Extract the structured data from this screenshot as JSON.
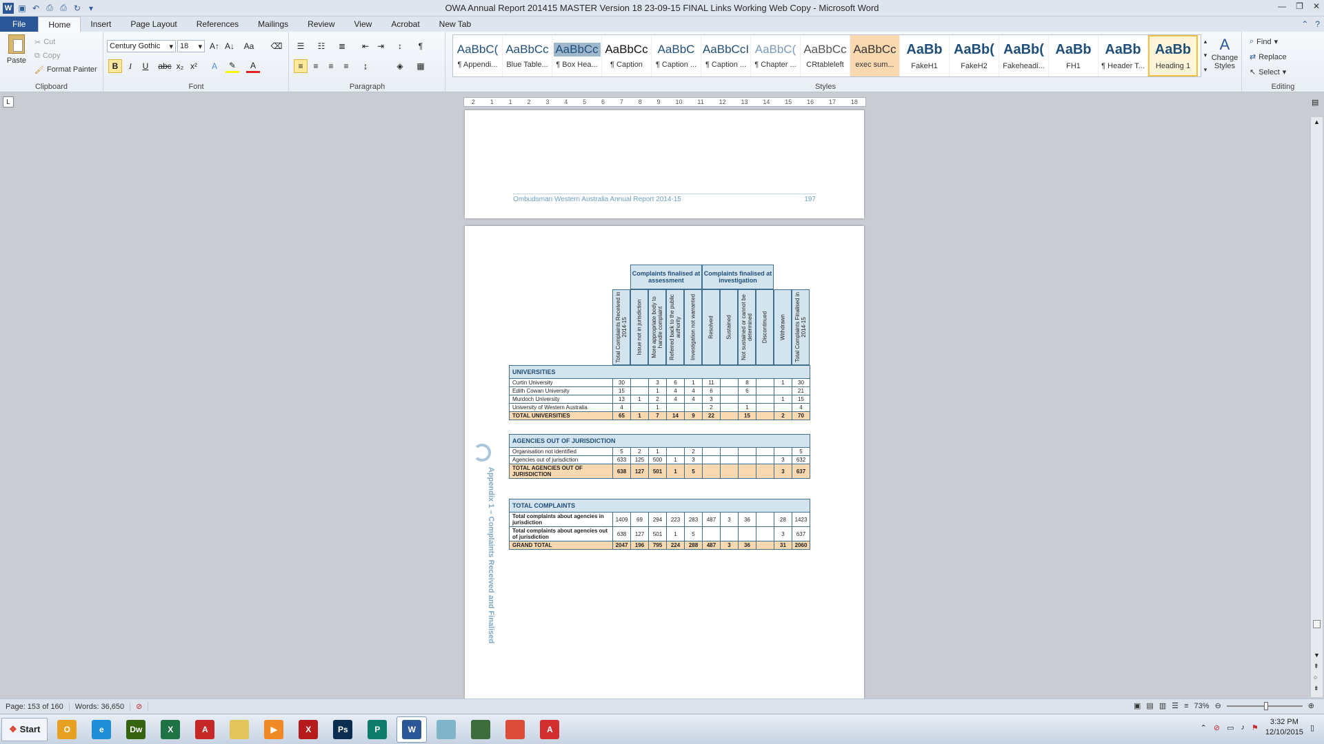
{
  "window": {
    "title": "OWA Annual Report 201415 MASTER Version 18 23-09-15 FINAL Links Working Web Copy - Microsoft Word"
  },
  "tabs": [
    "File",
    "Home",
    "Insert",
    "Page Layout",
    "References",
    "Mailings",
    "Review",
    "View",
    "Acrobat",
    "New Tab"
  ],
  "ribbon": {
    "clipboard": {
      "paste": "Paste",
      "cut": "Cut",
      "copy": "Copy",
      "format_painter": "Format Painter",
      "label": "Clipboard"
    },
    "font": {
      "name": "Century Gothic",
      "size": "18",
      "label": "Font"
    },
    "paragraph": {
      "label": "Paragraph"
    },
    "styles": {
      "label": "Styles",
      "items": [
        {
          "sample": "AaBbC(",
          "name": "¶ Appendi..."
        },
        {
          "sample": "AaBbCc",
          "name": "Blue Table..."
        },
        {
          "sample": "AaBbCc",
          "name": "¶ Box Hea..."
        },
        {
          "sample": "AaBbCc",
          "name": "¶ Caption"
        },
        {
          "sample": "AaBbC",
          "name": "¶ Caption ..."
        },
        {
          "sample": "AaBbCcI",
          "name": "¶ Caption ..."
        },
        {
          "sample": "AaBbC(",
          "name": "¶ Chapter ..."
        },
        {
          "sample": "AaBbCc",
          "name": "CRtableleft"
        },
        {
          "sample": "AaBbCc",
          "name": "exec sum..."
        },
        {
          "sample": "AaBb",
          "name": "FakeH1"
        },
        {
          "sample": "AaBb(",
          "name": "FakeH2"
        },
        {
          "sample": "AaBb(",
          "name": "Fakeheadi..."
        },
        {
          "sample": "AaBb",
          "name": "FH1"
        },
        {
          "sample": "AaBb",
          "name": "¶ Header T..."
        },
        {
          "sample": "AaBb",
          "name": "Heading 1"
        }
      ],
      "change_styles": "Change Styles"
    },
    "editing": {
      "find": "Find",
      "replace": "Replace",
      "select": "Select",
      "label": "Editing"
    }
  },
  "ruler": [
    "2",
    "1",
    "1",
    "2",
    "3",
    "4",
    "5",
    "6",
    "7",
    "8",
    "9",
    "10",
    "11",
    "12",
    "13",
    "14",
    "15",
    "16",
    "17",
    "18"
  ],
  "page1": {
    "footer": "Ombudsman Western Australia Annual Report 2014-15",
    "page_number": "197"
  },
  "page2": {
    "side_text": "Appendix 1 – Complaints Received and Finalised",
    "group_headers": [
      "Complaints finalised at assessment",
      "Complaints finalised at investigation"
    ],
    "column_headers": [
      "Total Complaints Received in 2014-15",
      "Issue not in jurisdiction",
      "More appropriate body to handle complaint",
      "Referred back to the public authority",
      "Investigation not warranted",
      "Resolved",
      "Sustained",
      "Not sustained or cannot be determined",
      "Discontinued",
      "Withdrawn",
      "Total Complaints Finalised in 2014-15"
    ],
    "sections": [
      {
        "title": "UNIVERSITIES",
        "rows": [
          {
            "label": "Curtin University",
            "values": [
              "30",
              "",
              "3",
              "6",
              "1",
              "11",
              "",
              "8",
              "",
              "1",
              "30"
            ]
          },
          {
            "label": "Edith Cowan University",
            "values": [
              "15",
              "",
              "1",
              "4",
              "4",
              "6",
              "",
              "6",
              "",
              "",
              "21"
            ]
          },
          {
            "label": "Murdoch University",
            "values": [
              "13",
              "1",
              "2",
              "4",
              "4",
              "3",
              "",
              "",
              "",
              "1",
              "15"
            ]
          },
          {
            "label": "University of Western Australia",
            "values": [
              "4",
              "",
              "1",
              "",
              "",
              "2",
              "",
              "1",
              "",
              "",
              "4"
            ]
          }
        ],
        "total": {
          "label": "TOTAL UNIVERSITIES",
          "values": [
            "65",
            "1",
            "7",
            "14",
            "9",
            "22",
            "",
            "15",
            "",
            "2",
            "70"
          ]
        }
      },
      {
        "title": "AGENCIES OUT OF JURISDICTION",
        "rows": [
          {
            "label": "Organisation not identified",
            "values": [
              "5",
              "2",
              "1",
              "",
              "2",
              "",
              "",
              "",
              "",
              "",
              "5"
            ]
          },
          {
            "label": "Agencies out of jurisdiction",
            "values": [
              "633",
              "125",
              "500",
              "1",
              "3",
              "",
              "",
              "",
              "",
              "3",
              "632"
            ]
          }
        ],
        "total": {
          "label": "TOTAL AGENCIES OUT OF JURISDICTION",
          "values": [
            "638",
            "127",
            "501",
            "1",
            "5",
            "",
            "",
            "",
            "",
            "3",
            "637"
          ]
        }
      },
      {
        "title": "TOTAL COMPLAINTS",
        "rows": [
          {
            "label": "Total complaints about agencies in jurisdiction",
            "values": [
              "1409",
              "69",
              "294",
              "223",
              "283",
              "487",
              "3",
              "36",
              "",
              "28",
              "1423"
            ],
            "bold": true
          },
          {
            "label": "Total complaints about agencies out of jurisdiction",
            "values": [
              "638",
              "127",
              "501",
              "1",
              "5",
              "",
              "",
              "",
              "",
              "3",
              "637"
            ],
            "bold": true
          }
        ],
        "total": {
          "label": "GRAND TOTAL",
          "values": [
            "2047",
            "196",
            "795",
            "224",
            "288",
            "487",
            "3",
            "36",
            "",
            "31",
            "2060"
          ]
        }
      }
    ]
  },
  "status": {
    "page": "Page: 153 of 160",
    "words": "Words: 36,650",
    "zoom": "73%"
  },
  "taskbar": {
    "start": "Start",
    "apps": [
      {
        "name": "outlook",
        "label": "O",
        "color": "#e8a020"
      },
      {
        "name": "internet-explorer",
        "label": "e",
        "color": "#1e8fd6"
      },
      {
        "name": "dreamweaver",
        "label": "Dw",
        "color": "#35630f"
      },
      {
        "name": "excel",
        "label": "X",
        "color": "#1f7244"
      },
      {
        "name": "acrobat-pro",
        "label": "A",
        "color": "#c62828"
      },
      {
        "name": "file-explorer",
        "label": "",
        "color": "#e3c35c"
      },
      {
        "name": "media-player",
        "label": "▶",
        "color": "#f08a24"
      },
      {
        "name": "x-app",
        "label": "X",
        "color": "#b71c1c"
      },
      {
        "name": "photoshop",
        "label": "Ps",
        "color": "#0b2d4f"
      },
      {
        "name": "publisher",
        "label": "P",
        "color": "#0f7b6b"
      },
      {
        "name": "word",
        "label": "W",
        "color": "#2b5797"
      },
      {
        "name": "notepad",
        "label": "",
        "color": "#7fb4c9"
      },
      {
        "name": "terminal",
        "label": "",
        "color": "#3d6d3d"
      },
      {
        "name": "chrome",
        "label": "",
        "color": "#dd4b39"
      },
      {
        "name": "adobe-reader",
        "label": "A",
        "color": "#d32f2f"
      }
    ],
    "time": "3:32 PM",
    "date": "12/10/2015"
  }
}
